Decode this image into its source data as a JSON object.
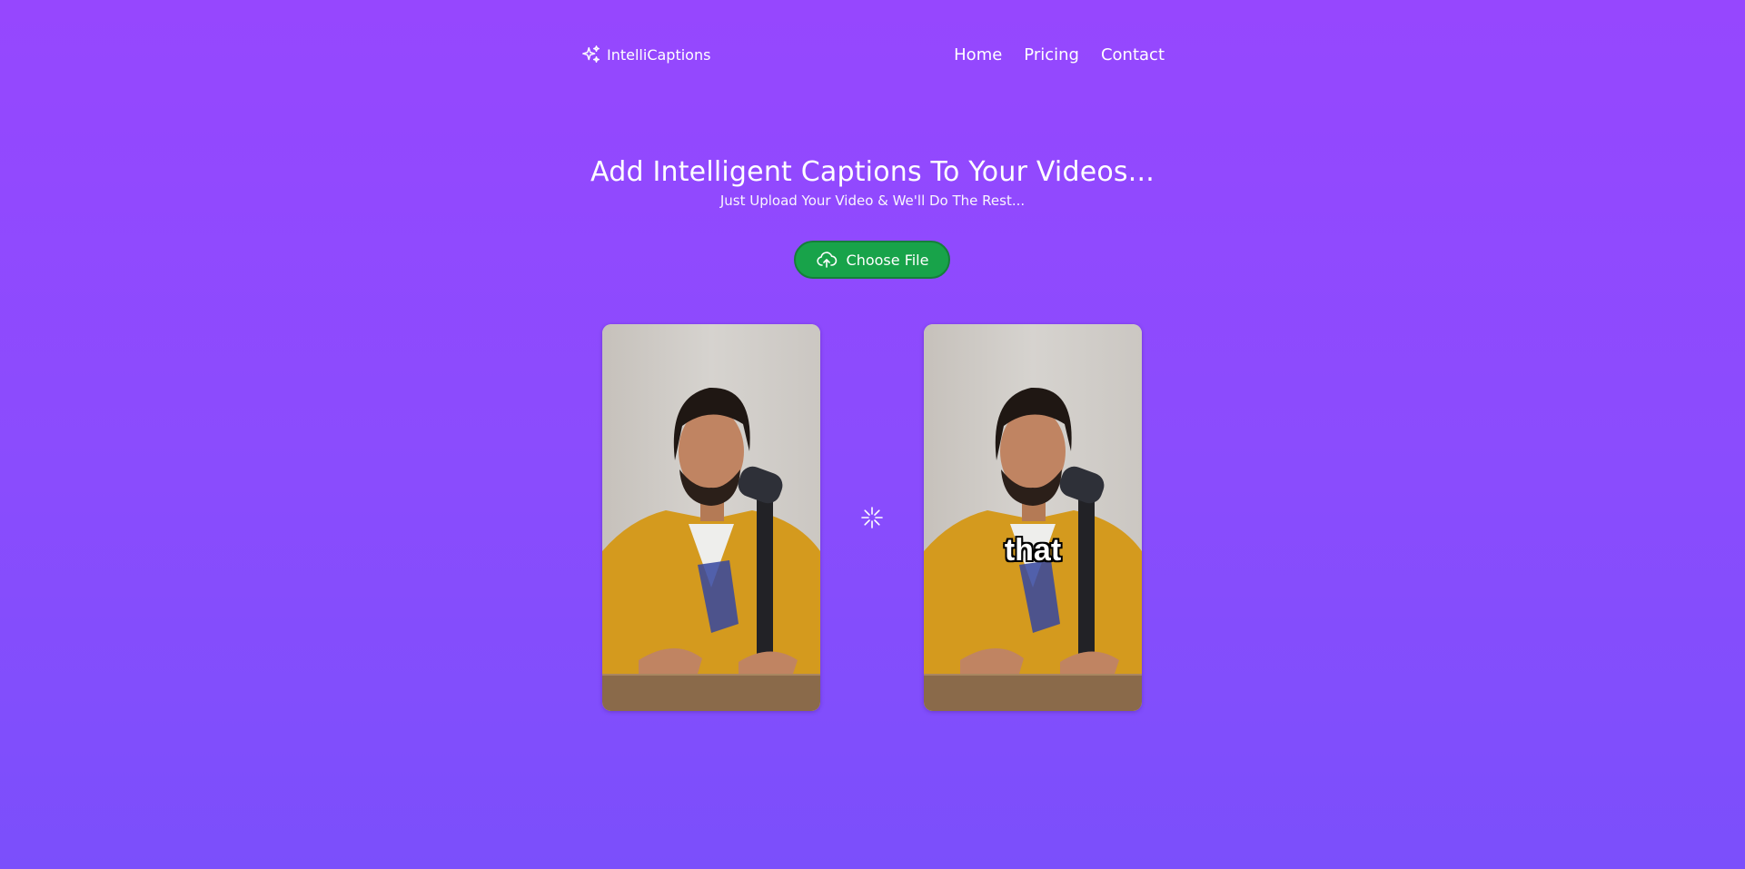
{
  "brand": {
    "name": "IntelliCaptions",
    "icon": "sparkles-icon"
  },
  "nav": {
    "links": [
      {
        "label": "Home"
      },
      {
        "label": "Pricing"
      },
      {
        "label": "Contact"
      }
    ]
  },
  "hero": {
    "title": "Add Intelligent Captions To Your Videos...",
    "subtitle": "Just Upload Your Video & We'll Do The Rest..."
  },
  "upload": {
    "button_label": "Choose File",
    "icon": "cloud-upload-icon",
    "button_color": "#18a34a"
  },
  "preview": {
    "original_video": {
      "caption": ""
    },
    "captioned_video": {
      "caption": "that"
    },
    "processing_icon": "loader-icon"
  },
  "colors": {
    "background_top": "#9647fe",
    "background_bottom": "#7b4ffb",
    "accent_green": "#18a34a"
  }
}
